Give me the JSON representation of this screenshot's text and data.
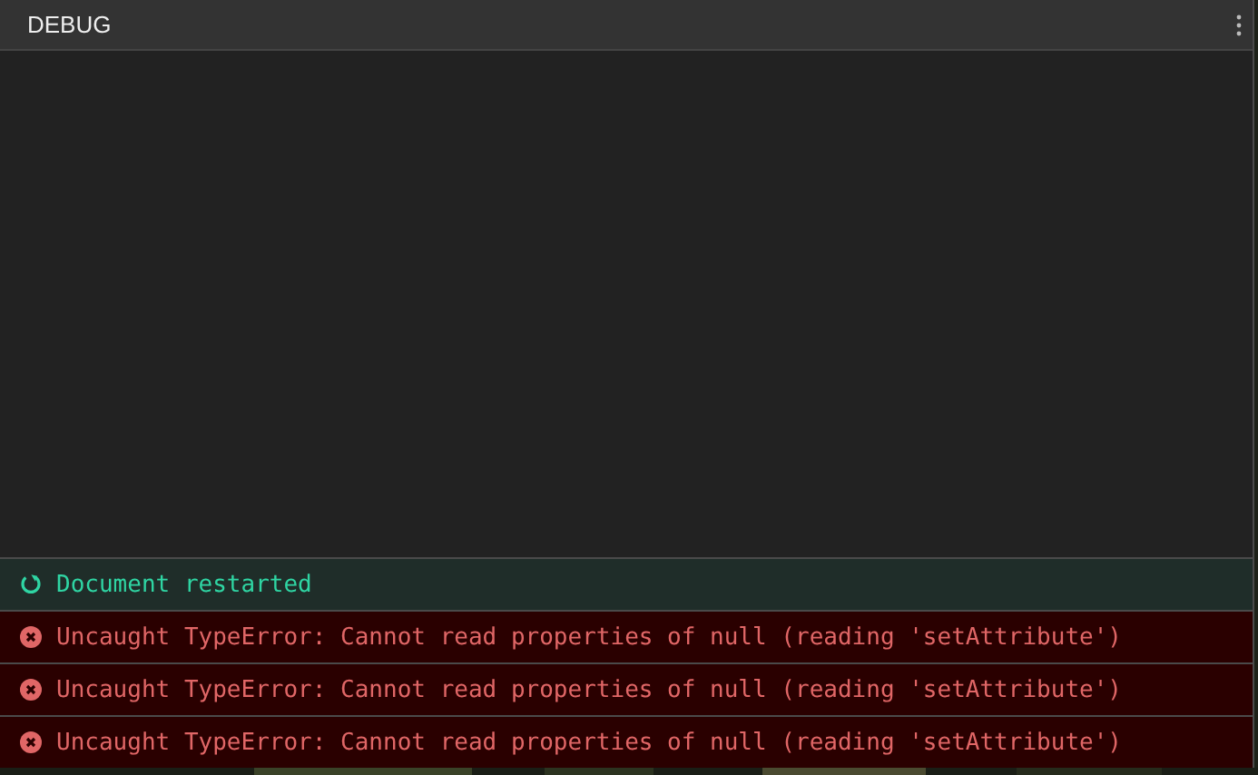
{
  "panel": {
    "title": "DEBUG"
  },
  "log": [
    {
      "kind": "info",
      "message": "Document restarted"
    },
    {
      "kind": "error",
      "message": "Uncaught TypeError: Cannot read properties of null (reading 'setAttribute')"
    },
    {
      "kind": "error",
      "message": "Uncaught TypeError: Cannot read properties of null (reading 'setAttribute')"
    },
    {
      "kind": "error",
      "message": "Uncaught TypeError: Cannot read properties of null (reading 'setAttribute')"
    }
  ]
}
